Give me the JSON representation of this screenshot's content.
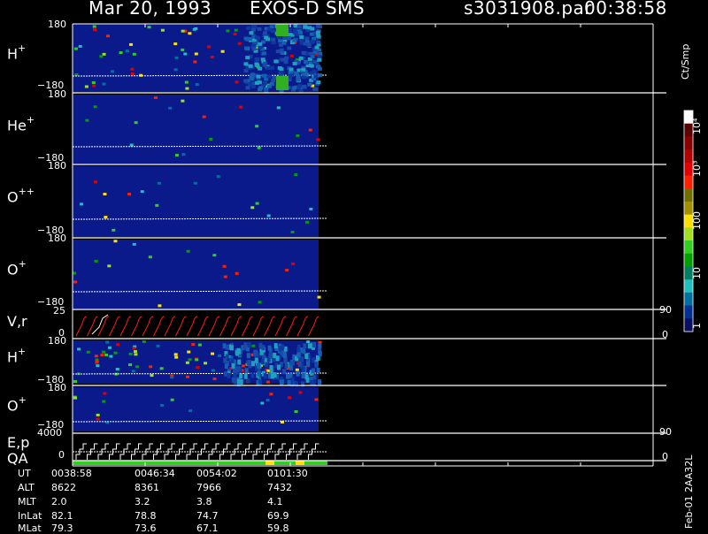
{
  "header": {
    "date": "Mar 20, 1993",
    "instrument": "EXOS-D SMS",
    "file": "s3031908.par",
    "time": "00:38:58"
  },
  "panels": [
    {
      "label": "H",
      "sup": "+",
      "top": "180",
      "bottom": "−180"
    },
    {
      "label": "He",
      "sup": "+",
      "top": "180",
      "bottom": "−180"
    },
    {
      "label": "O",
      "sup": "++",
      "top": "180",
      "bottom": "−180"
    },
    {
      "label": "O",
      "sup": "+",
      "top": "180",
      "bottom": "−180"
    },
    {
      "label": "V,r",
      "sup": "",
      "top": "25",
      "bottom": "0"
    },
    {
      "label": "H",
      "sup": "+",
      "top": "180",
      "bottom": "−180"
    },
    {
      "label": "O",
      "sup": "+",
      "top": "180",
      "bottom": "−180"
    },
    {
      "label": "E,p",
      "sup": "",
      "top": "4000",
      "bottom": "0"
    }
  ],
  "qa_label": "QA",
  "right_axes": {
    "vr": {
      "top": "90",
      "bottom": "0"
    },
    "ep": {
      "top": "90",
      "bottom": "0"
    }
  },
  "colorbar": {
    "unit": "Ct/Smp",
    "ticks": [
      "10⁴",
      "10³",
      "100",
      "10",
      "1"
    ],
    "colors": [
      "#ffffff",
      "#5a0000",
      "#8a0000",
      "#b00000",
      "#e00000",
      "#ff2000",
      "#707000",
      "#a09000",
      "#ffe000",
      "#a0e020",
      "#30d020",
      "#00a000",
      "#008060",
      "#20c0c0",
      "#0070a0",
      "#003090",
      "#0a1060"
    ]
  },
  "time_table": {
    "rows": [
      {
        "name": "UT",
        "values": [
          "0038:58",
          "0046:34",
          "0054:02",
          "0101:30"
        ]
      },
      {
        "name": "ALT",
        "values": [
          "8622",
          "8361",
          "7966",
          "7432"
        ]
      },
      {
        "name": "MLT",
        "values": [
          "2.0",
          "3.2",
          "3.8",
          "4.1"
        ]
      },
      {
        "name": "InLat",
        "values": [
          "82.1",
          "78.8",
          "74.7",
          "69.9"
        ]
      },
      {
        "name": "MLat",
        "values": [
          "79.3",
          "73.6",
          "67.1",
          "59.8"
        ]
      }
    ]
  },
  "footer_id": "Feb-01 2AA32L",
  "chart_data": {
    "type": "heatmap",
    "title": "Mar 20, 1993   EXOS-D SMS",
    "x": [
      "0038:58",
      "0046:34",
      "0054:02",
      "0101:30"
    ],
    "panels": [
      {
        "name": "H+",
        "ylim": [
          -180,
          180
        ]
      },
      {
        "name": "He+",
        "ylim": [
          -180,
          180
        ]
      },
      {
        "name": "O++",
        "ylim": [
          -180,
          180
        ]
      },
      {
        "name": "O+",
        "ylim": [
          -180,
          180
        ]
      },
      {
        "name": "V,r",
        "ylim": [
          0,
          25
        ],
        "right_ylim": [
          0,
          90
        ]
      },
      {
        "name": "H+",
        "ylim": [
          -180,
          180
        ]
      },
      {
        "name": "O+",
        "ylim": [
          -180,
          180
        ]
      },
      {
        "name": "E,p",
        "ylim": [
          0,
          4000
        ],
        "right_ylim": [
          0,
          90
        ]
      }
    ],
    "colorbar": {
      "label": "Ct/Smp",
      "scale": "log",
      "range": [
        1,
        10000
      ],
      "ticks": [
        "1",
        "10",
        "100",
        "10³",
        "10⁴"
      ]
    },
    "background_color": "#0a1a8a"
  }
}
